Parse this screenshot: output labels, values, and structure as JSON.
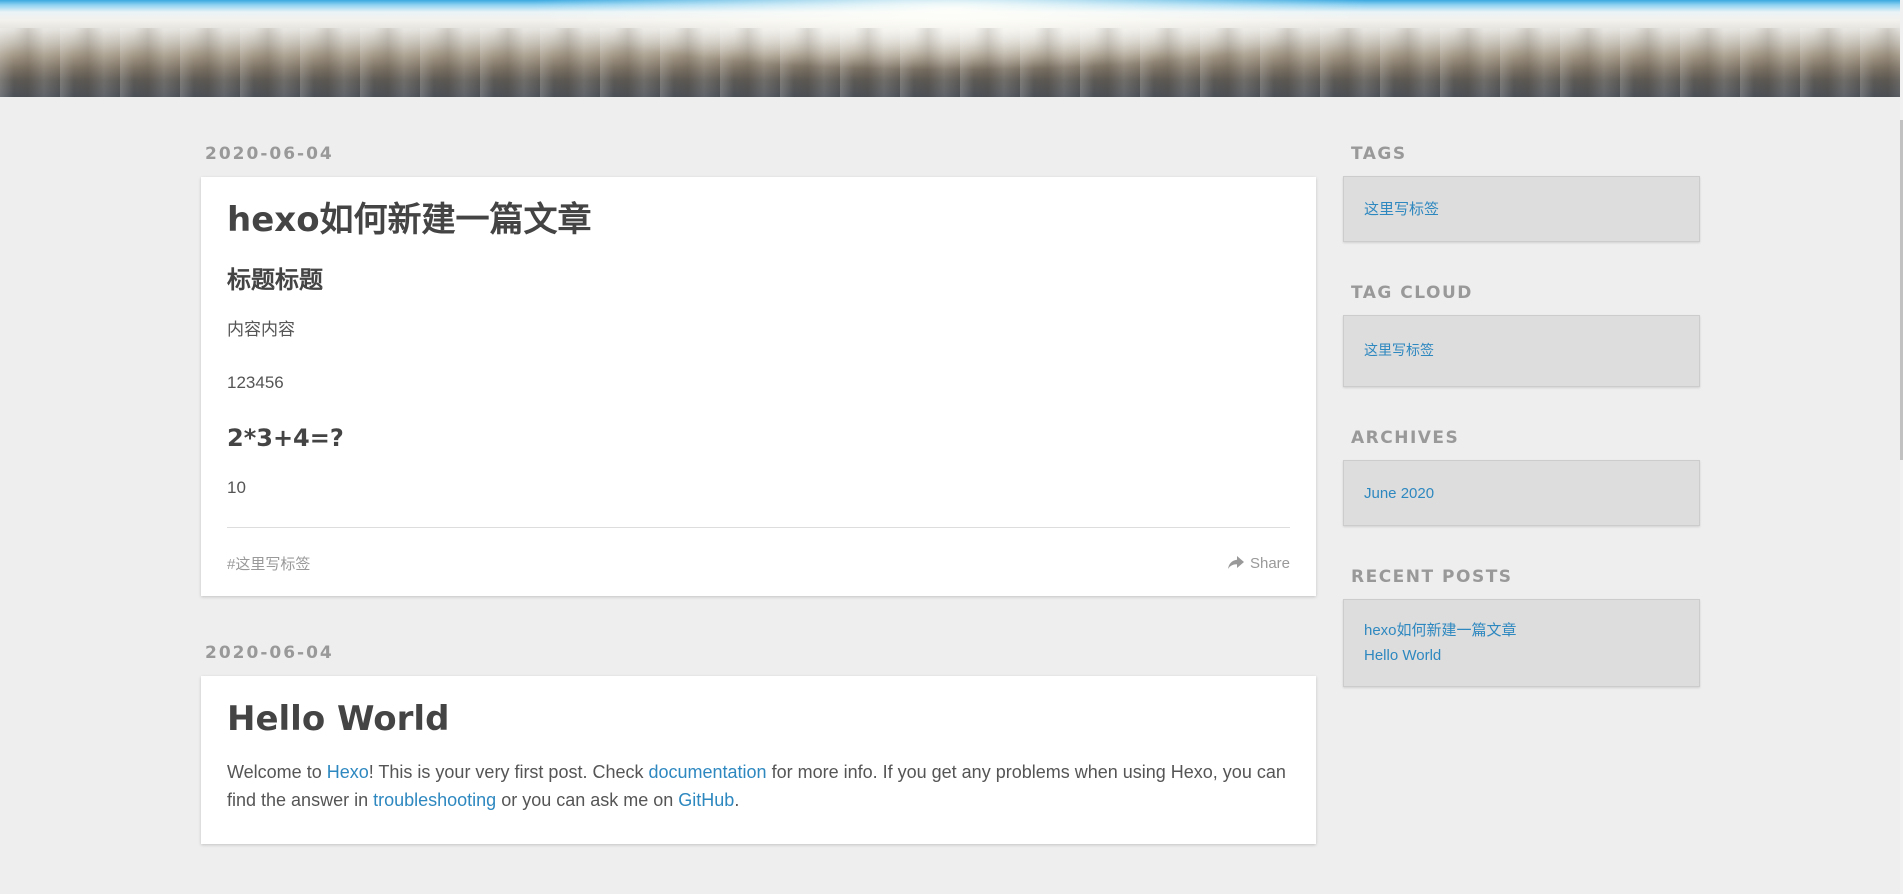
{
  "posts": [
    {
      "date": "2020-06-04",
      "title": "hexo如何新建一篇文章",
      "heading1": "标题标题",
      "para1": "内容内容",
      "para2": "123456",
      "heading2": "2*3+4=?",
      "para3": "10",
      "tag": "#这里写标签",
      "share": "Share"
    },
    {
      "date": "2020-06-04",
      "title": "Hello World",
      "intro": {
        "t1": "Welcome to ",
        "link1": "Hexo",
        "t2": "! This is your very first post. Check ",
        "link2": "documentation",
        "t3": " for more info. If you get any problems when using Hexo, you can find the answer in ",
        "link3": "troubleshooting",
        "t4": " or you can ask me on ",
        "link4": "GitHub",
        "t5": "."
      }
    }
  ],
  "sidebar": {
    "tags": {
      "title": "TAGS",
      "items": [
        "这里写标签"
      ]
    },
    "tag_cloud": {
      "title": "TAG CLOUD",
      "items": [
        "这里写标签"
      ]
    },
    "archives": {
      "title": "ARCHIVES",
      "items": [
        "June 2020"
      ]
    },
    "recent_posts": {
      "title": "RECENT POSTS",
      "items": [
        "hexo如何新建一篇文章",
        "Hello World"
      ]
    }
  },
  "icons": {
    "share": "share-arrow-icon"
  },
  "colors": {
    "link": "#2e88c0",
    "muted": "#999999",
    "text": "#555555",
    "background": "#eeeeee"
  }
}
